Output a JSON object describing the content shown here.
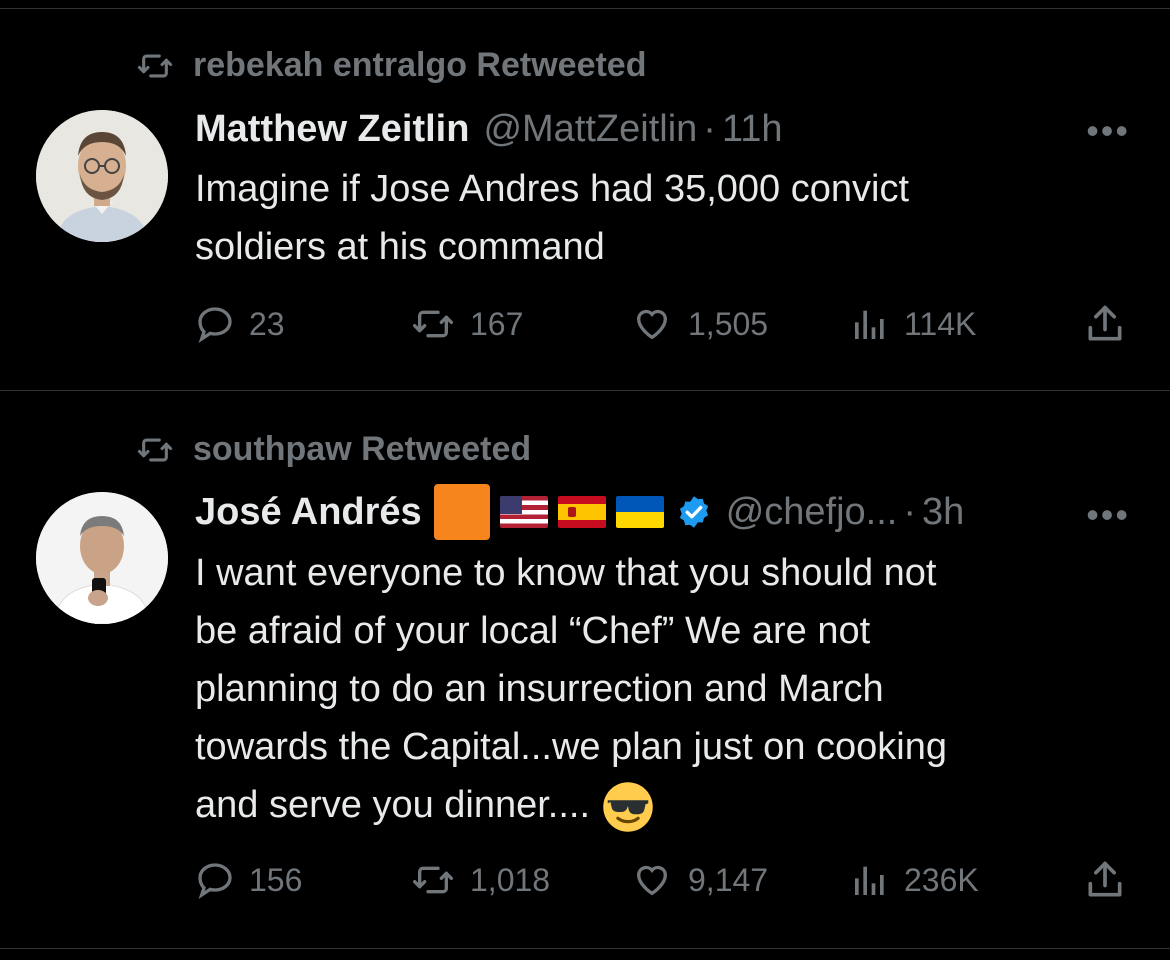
{
  "tweets": [
    {
      "retweeted_by": "rebekah entralgo Retweeted",
      "author_name": "Matthew Zeitlin",
      "handle": "@MattZeitlin",
      "dot": "·",
      "time": "11h",
      "text_lines": [
        "Imagine if Jose Andres had 35,000 convict",
        "soldiers at his command"
      ],
      "stats": {
        "replies": "23",
        "retweets": "167",
        "likes": "1,505",
        "views": "114K"
      }
    },
    {
      "retweeted_by": "southpaw Retweeted",
      "author_name": "José Andrés",
      "handle": "@chefjo...",
      "dot": "·",
      "time": "3h",
      "text_lines": [
        "I want everyone to know that you should not",
        "be afraid of your local “Chef” We are not",
        "planning to do an insurrection and March",
        "towards the Capital...we plan just on cooking",
        "and serve you dinner...."
      ],
      "stats": {
        "replies": "156",
        "retweets": "1,018",
        "likes": "9,147",
        "views": "236K"
      }
    }
  ],
  "more_label": "•••",
  "icons": {
    "retweet": "retweet-icon",
    "reply": "reply-icon",
    "like": "heart-icon",
    "views": "views-icon",
    "share": "share-icon",
    "verified": "verified-badge-icon",
    "emoji": "sunglasses-emoji"
  },
  "colors": {
    "background": "#000000",
    "text": "#e7e9ea",
    "muted": "#71767b",
    "verified": "#1d9bf0",
    "divider": "#2f3336"
  }
}
